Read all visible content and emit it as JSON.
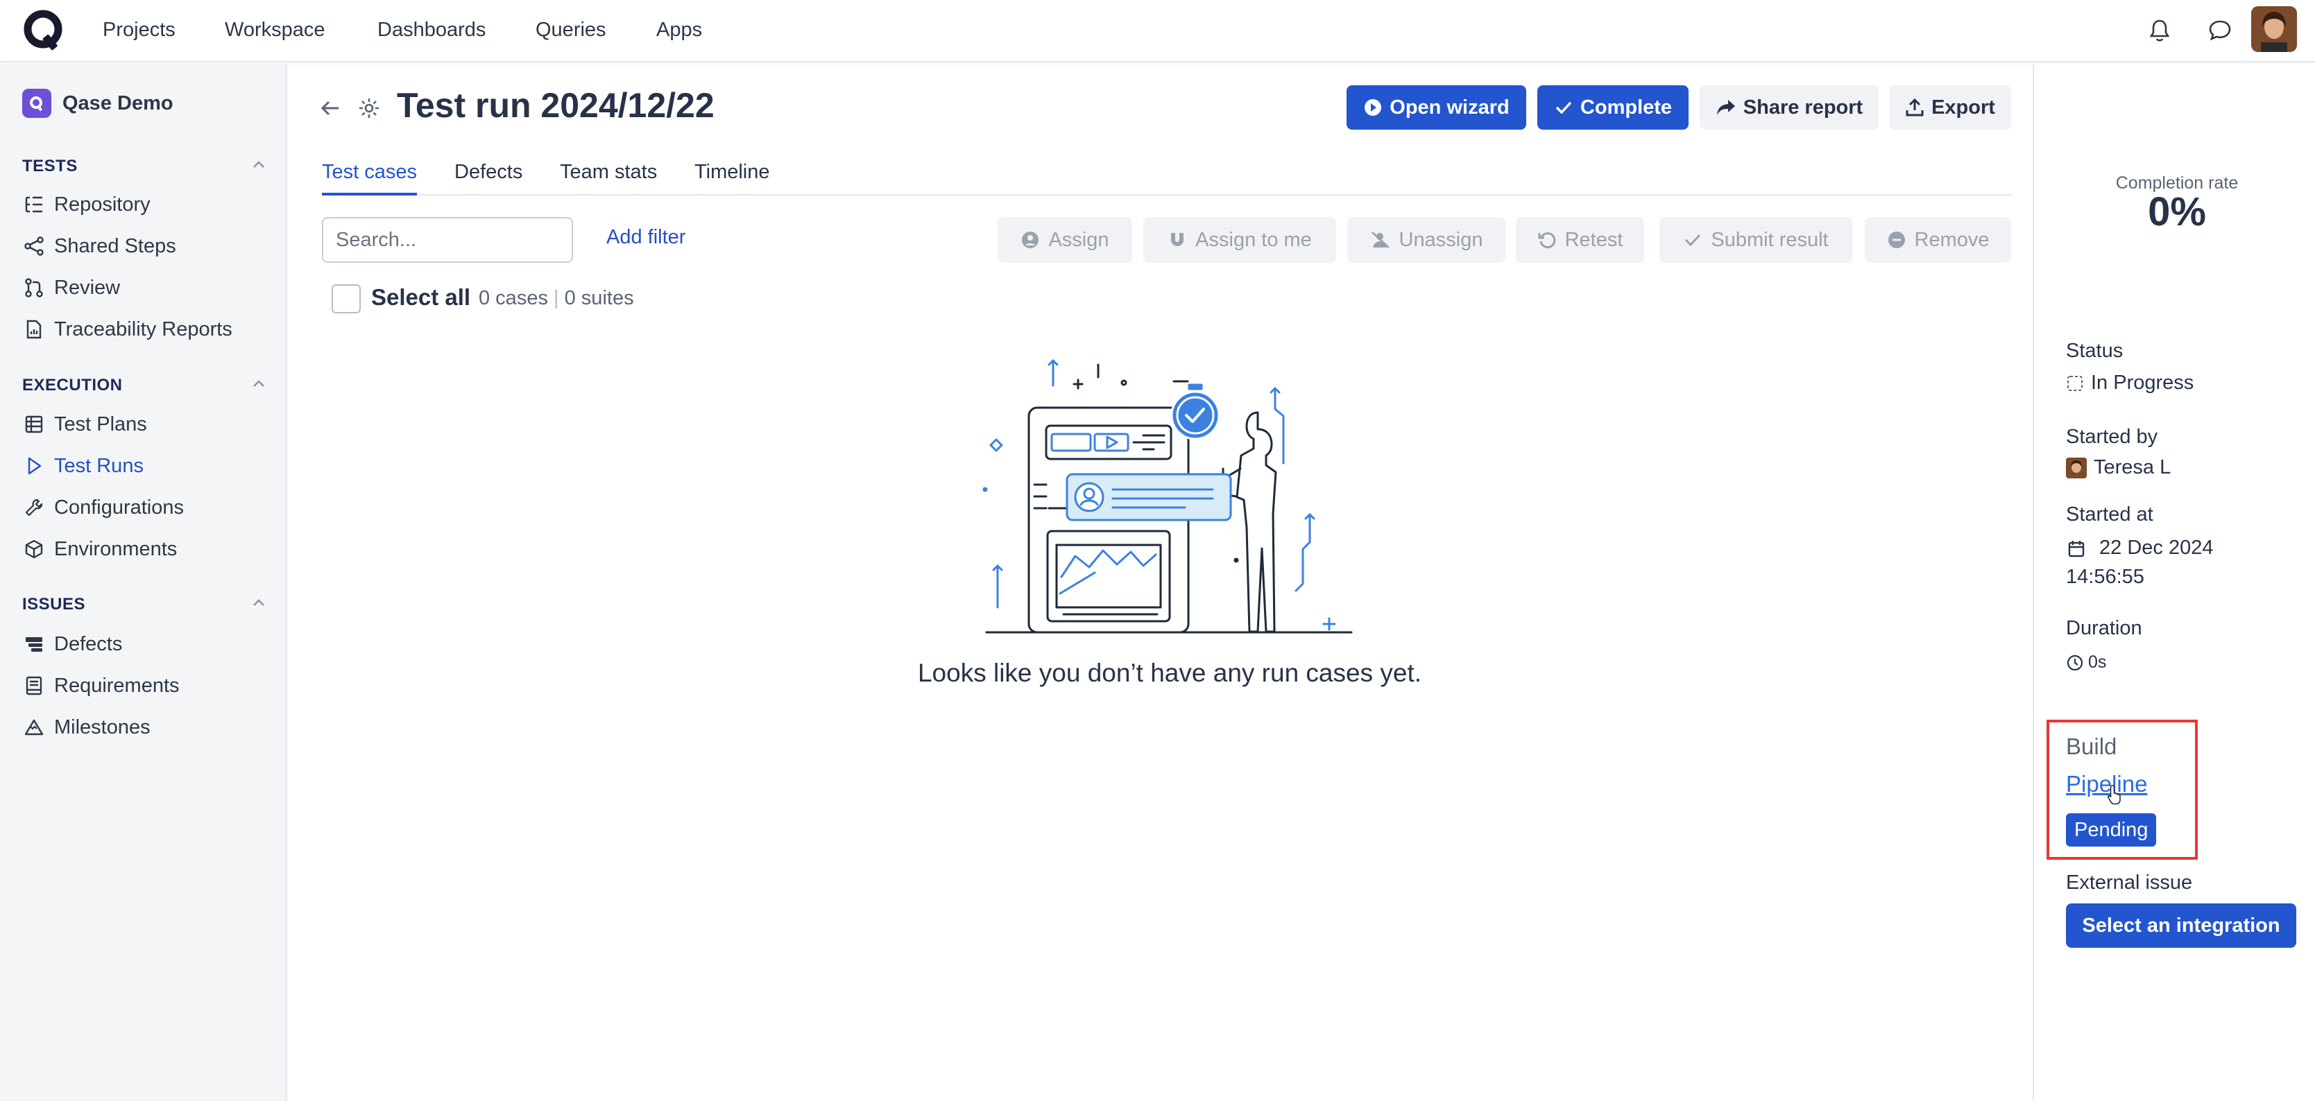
{
  "app": {
    "logo_icon": "qase-logo-icon",
    "nav": [
      "Projects",
      "Workspace",
      "Dashboards",
      "Queries",
      "Apps"
    ],
    "icons": [
      "bell-icon",
      "chat-icon",
      "avatar"
    ]
  },
  "sidebar": {
    "project_name": "Qase Demo",
    "sections": {
      "tests": {
        "title": "TESTS",
        "items": [
          "Repository",
          "Shared Steps",
          "Review",
          "Traceability Reports"
        ]
      },
      "execution": {
        "title": "EXECUTION",
        "items": [
          "Test Plans",
          "Test Runs",
          "Configurations",
          "Environments"
        ]
      },
      "issues": {
        "title": "ISSUES",
        "items": [
          "Defects",
          "Requirements",
          "Milestones"
        ]
      }
    },
    "active_item": "Test Runs"
  },
  "header": {
    "title": "Test run 2024/12/22",
    "buttons": {
      "open_wizard": "Open wizard",
      "complete": "Complete",
      "share_report": "Share report",
      "export": "Export"
    }
  },
  "tabs": [
    "Test cases",
    "Defects",
    "Team stats",
    "Timeline"
  ],
  "active_tab": "Test cases",
  "toolbar": {
    "search_placeholder": "Search...",
    "add_filter": "Add filter",
    "actions": {
      "assign": "Assign",
      "assign_to_me": "Assign to me",
      "unassign": "Unassign",
      "retest": "Retest",
      "submit_result": "Submit result",
      "remove": "Remove"
    }
  },
  "selection": {
    "select_all": "Select all",
    "cases": "0 cases",
    "suites": "0 suites",
    "separator": "|"
  },
  "empty_state": {
    "message": "Looks like you don’t have any run cases yet."
  },
  "details": {
    "completion_label": "Completion rate",
    "completion_value": "0%",
    "status_label": "Status",
    "status_value": "In Progress",
    "started_by_label": "Started by",
    "started_by_value": "Teresa L",
    "started_at_label": "Started at",
    "started_at_date": "22 Dec 2024",
    "started_at_time": "14:56:55",
    "duration_label": "Duration",
    "duration_value": "0s",
    "build_label": "Build",
    "build_link": "Pipeline",
    "build_status": "Pending",
    "external_issue_label": "External issue",
    "select_integration": "Select an integration"
  },
  "colors": {
    "primary": "#2355cf",
    "link": "#2a6de0",
    "highlight_box": "#e53935",
    "sidebar_bg": "#f4f5f7",
    "project_icon": "#6d4fd8"
  }
}
